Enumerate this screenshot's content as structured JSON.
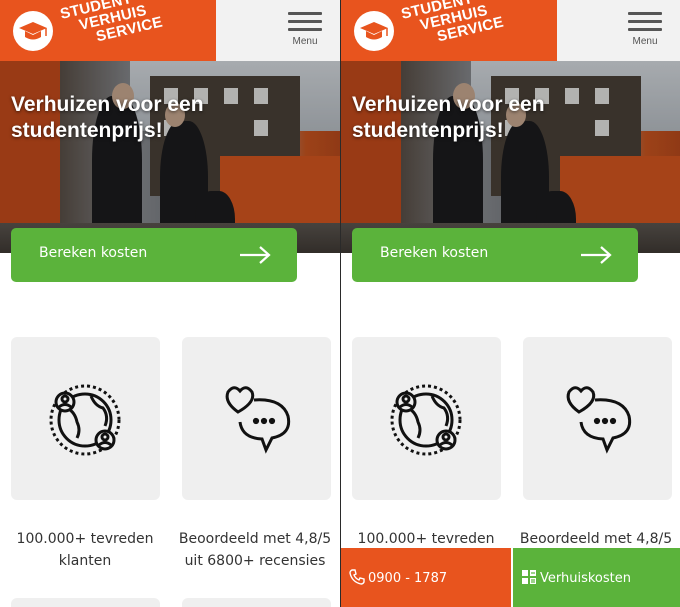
{
  "header": {
    "logo_lines": [
      "STUDENT",
      "VERHUIS",
      "SERVICE"
    ],
    "menu_label": "Menu"
  },
  "hero": {
    "title": "Verhuizen voor een studentenprijs!",
    "cta_label": "Bereken kosten",
    "cta_icon": "arrow-right-icon"
  },
  "features": [
    {
      "icon": "globe-users-icon",
      "text_line1": "100.000+ tevreden",
      "text_line2": "klanten"
    },
    {
      "icon": "heart-speech-bubble-icon",
      "text_line1": "Beoordeeld met 4,8/5",
      "text_line2": "uit 6800+ recensies"
    }
  ],
  "sticky_bar": {
    "phone_label": "0900 - 1787",
    "phone_icon": "phone-icon",
    "costs_label": "Verhuiskosten",
    "costs_icon": "calculator-icon"
  },
  "colors": {
    "brand_orange": "#e8541e",
    "cta_green": "#5bb33b",
    "card_gray": "#efefef",
    "header_gray": "#f2f2f2"
  }
}
